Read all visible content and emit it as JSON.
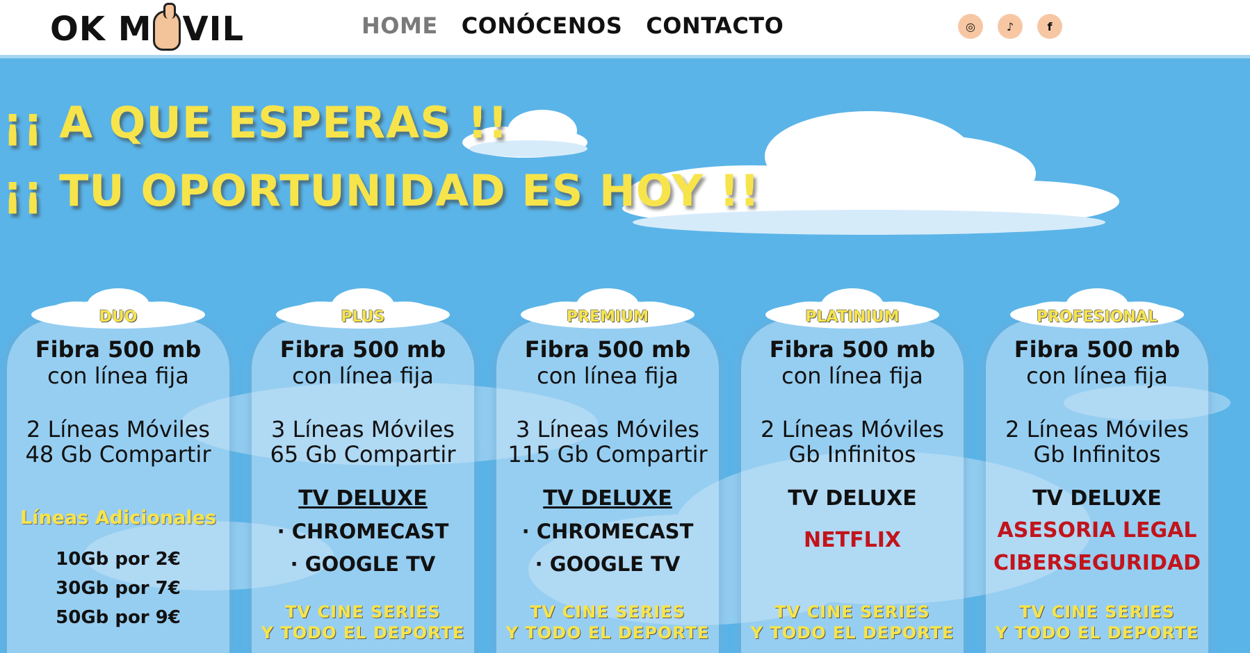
{
  "header": {
    "logo_text_left": "OK M",
    "logo_text_right": "VIL",
    "nav": [
      {
        "label": "HOME"
      },
      {
        "label": "CONÓCENOS"
      },
      {
        "label": "CONTACTO"
      }
    ],
    "social": [
      {
        "icon": "instagram-icon",
        "glyph": "◎"
      },
      {
        "icon": "tiktok-icon",
        "glyph": "♪"
      },
      {
        "icon": "facebook-icon",
        "glyph": "f"
      }
    ]
  },
  "hero": {
    "line1": "¡¡ A QUE ESPERAS !!",
    "line2": "¡¡ TU OPORTUNIDAD ES HOY !!"
  },
  "plans": [
    {
      "name": "DUO",
      "fibra": "Fibra 500 mb",
      "fibra_sub": "con línea fija",
      "lines1": "2 Líneas Móviles",
      "lines2": "48 Gb Compartir",
      "extra_title": "Líneas Adicionales",
      "extras": [
        "10Gb por 2€",
        "30Gb por 7€",
        "50Gb por 9€"
      ]
    },
    {
      "name": "PLUS",
      "fibra": "Fibra 500 mb",
      "fibra_sub": "con línea fija",
      "lines1": "3 Líneas Móviles",
      "lines2": "65 Gb Compartir",
      "tv": "TV DELUXE",
      "bullets": [
        "· CHROMECAST",
        "· GOOGLE TV"
      ],
      "tvcine1": "TV  CINE  SERIES",
      "tvcine2": "Y TODO EL DEPORTE"
    },
    {
      "name": "PREMIUM",
      "fibra": "Fibra 500 mb",
      "fibra_sub": "con línea fija",
      "lines1": "3 Líneas Móviles",
      "lines2": "115 Gb Compartir",
      "tv": "TV DELUXE",
      "bullets": [
        "· CHROMECAST",
        "· GOOGLE TV"
      ],
      "tvcine1": "TV  CINE  SERIES",
      "tvcine2": "Y TODO EL DEPORTE"
    },
    {
      "name": "PLATINIUM",
      "fibra": "Fibra 500 mb",
      "fibra_sub": "con línea fija",
      "lines1": "2 Líneas Móviles",
      "lines2": "Gb Infinitos",
      "tv": "TV DELUXE",
      "red": [
        "NETFLIX"
      ],
      "tvcine1": "TV  CINE  SERIES",
      "tvcine2": "Y TODO EL DEPORTE"
    },
    {
      "name": "PROFESIONAL",
      "fibra": "Fibra 500 mb",
      "fibra_sub": "con línea fija",
      "lines1": "2 Líneas Móviles",
      "lines2": "Gb Infinitos",
      "tv": "TV DELUXE",
      "red": [
        "ASESORIA LEGAL",
        "CIBERSEGURIDAD"
      ],
      "tvcine1": "TV  CINE  SERIES",
      "tvcine2": "Y TODO EL DEPORTE"
    }
  ]
}
